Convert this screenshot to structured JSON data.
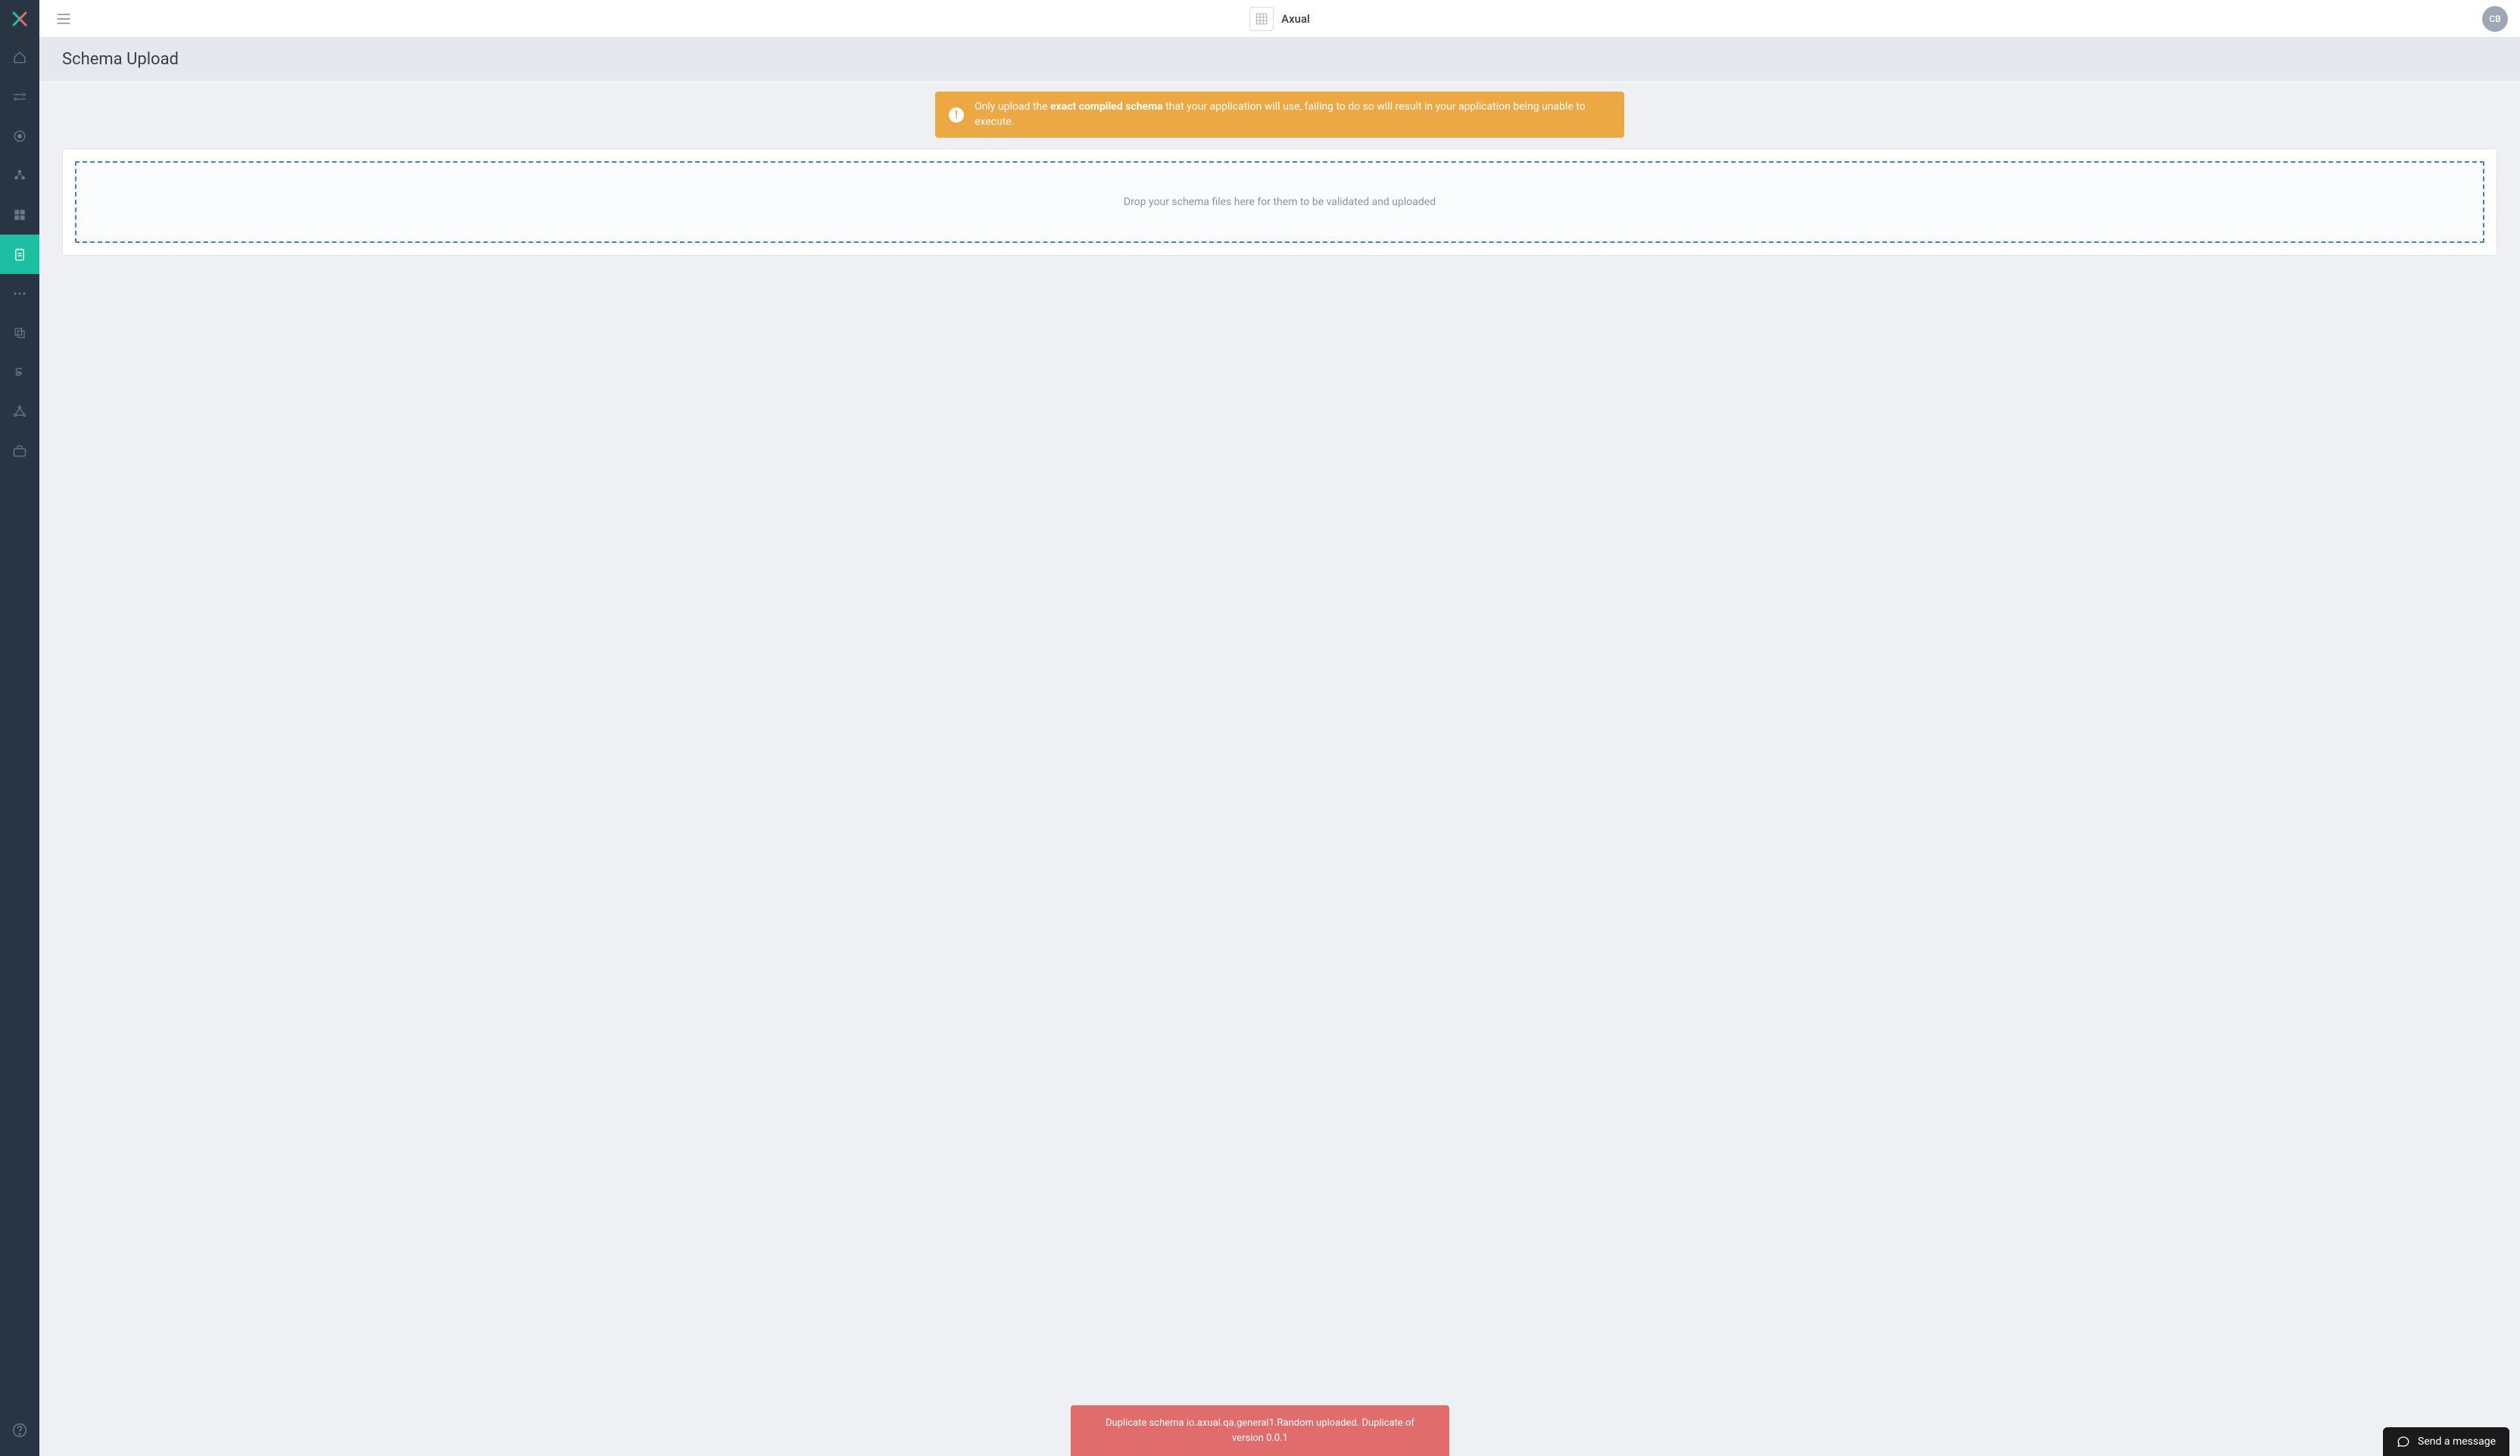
{
  "topbar": {
    "app_title": "Axual",
    "avatar_initials": "CB"
  },
  "page": {
    "title": "Schema Upload"
  },
  "warning": {
    "prefix": "Only upload the ",
    "bold": "exact compiled schema",
    "suffix": " that your application will use, failing to do so will result in your application being unable to execute."
  },
  "dropzone": {
    "text": "Drop your schema files here for them to be validated and uploaded"
  },
  "error": {
    "text": "Duplicate schema io.axual.qa.general1.Random uploaded. Duplicate of version 0.0.1"
  },
  "chat": {
    "label": "Send a message"
  },
  "sidebar": {
    "items": [
      {
        "name": "home"
      },
      {
        "name": "streams"
      },
      {
        "name": "target"
      },
      {
        "name": "cluster"
      },
      {
        "name": "apps"
      },
      {
        "name": "schema",
        "active": true
      },
      {
        "name": "more"
      },
      {
        "name": "copy"
      },
      {
        "name": "billing"
      },
      {
        "name": "integrations"
      },
      {
        "name": "briefcase"
      }
    ]
  }
}
